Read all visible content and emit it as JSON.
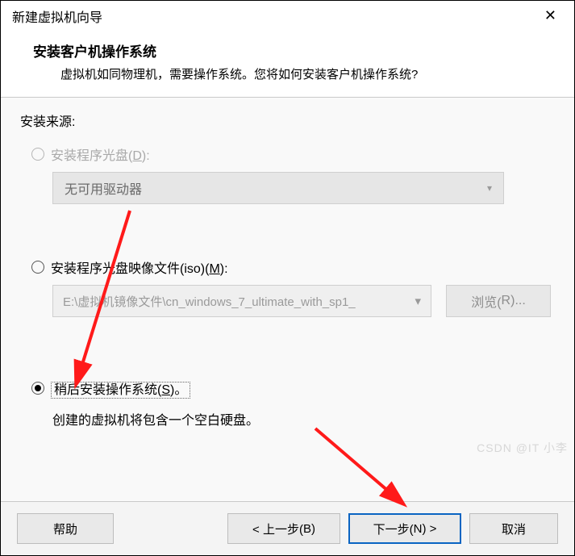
{
  "window": {
    "title": "新建虚拟机向导"
  },
  "header": {
    "heading": "安装客户机操作系统",
    "subheading": "虚拟机如同物理机，需要操作系统。您将如何安装客户机操作系统?"
  },
  "body": {
    "source_label": "安装来源:",
    "option1": {
      "label_pre": "安装程序光盘(",
      "hotkey": "D",
      "label_post": "):",
      "dropdown_text": "无可用驱动器"
    },
    "option2": {
      "label_pre": "安装程序光盘映像文件(iso)(",
      "hotkey": "M",
      "label_post": "):",
      "path": "E:\\虚拟机镜像文件\\cn_windows_7_ultimate_with_sp1_",
      "browse_pre": "浏览(",
      "browse_hotkey": "R",
      "browse_post": ")..."
    },
    "option3": {
      "label_pre": "稍后安装操作系统(",
      "hotkey": "S",
      "label_post": ")。",
      "hint": "创建的虚拟机将包含一个空白硬盘。"
    }
  },
  "footer": {
    "help": "帮助",
    "back_pre": "< 上一步(",
    "back_hotkey": "B",
    "back_post": ")",
    "next_pre": "下一步(",
    "next_hotkey": "N",
    "next_post": ") >",
    "cancel": "取消"
  },
  "watermark": "CSDN @IT 小李"
}
